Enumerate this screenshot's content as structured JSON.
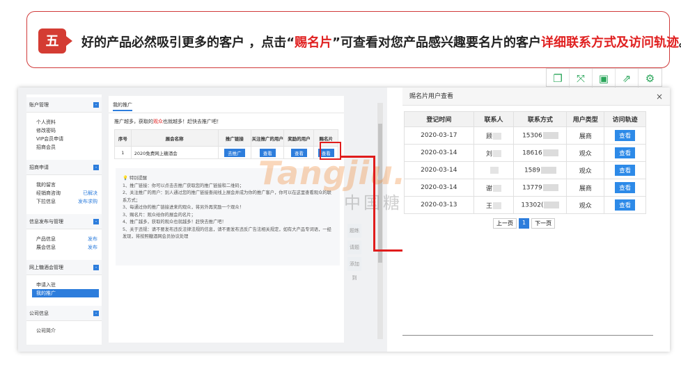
{
  "banner": {
    "step": "五",
    "text_part1": "好的产品必然吸引更多的客户 ，点击“",
    "text_red1": "赐名片",
    "text_part2": "”可查看对您产品感兴趣要名片的客户",
    "text_red2": "详细联系方式及访问轨迹",
    "text_part3": "。"
  },
  "toolbar": {
    "icons": [
      "copy-icon",
      "expand-icon",
      "save-icon",
      "share-icon",
      "settings-icon"
    ]
  },
  "sidebar": {
    "sections": [
      {
        "title": "账户管理",
        "items": [
          {
            "label": "个人资料"
          },
          {
            "label": "修改密码"
          },
          {
            "label": "VIP会员申请"
          },
          {
            "label": "招商会员"
          }
        ]
      },
      {
        "title": "招商申请",
        "items": [
          {
            "label": "我的留言"
          },
          {
            "label": "经销商咨询",
            "extra": "已解决"
          },
          {
            "label": "下拉信息",
            "extra": "发布求购"
          }
        ]
      },
      {
        "title": "信息发布与管理",
        "items": [
          {
            "label": "产品信息",
            "extra": "发布"
          },
          {
            "label": "展会信息",
            "extra": "发布"
          }
        ]
      },
      {
        "title": "网上糖酒会管理",
        "items": [
          {
            "label": "申请入驻"
          },
          {
            "label": "我的推广"
          }
        ]
      },
      {
        "title": "公司信息",
        "items": [
          {
            "label": "公司简介"
          }
        ]
      }
    ]
  },
  "content": {
    "tab": "我的推广",
    "hint_pre": "推广越多，获取的",
    "hint_red": "观众",
    "hint_post": "也就越多！赶快去推广吧！",
    "table_headers": [
      "序号",
      "展会名称",
      "推广链接",
      "关注推广的用户",
      "奖励的用户",
      "赐名片"
    ],
    "row": {
      "no": "1",
      "name": "2020免费网上糖酒会",
      "b1": "去推广",
      "b2": "查看",
      "b3": "查看",
      "b4": "查看"
    },
    "notice_title": "特别提醒",
    "notice_lines": [
      "1、推广链接：你可以点击去推广获取您的推广链接和二维码；",
      "2、关注推广的用户：别人通过您的推广链接查阅线上展会并成为你的推广客户，你可以在这里查看观众的联系方式；",
      "3、每通过你的推广链接进来的观众，将另外再奖励一个观众！",
      "3、赐名片：观众给你的展会的名片；",
      "4、推广越多，获取的观众也就越多！赶快去推广吧！",
      "5、关于违规：请不要发布违反法律法规的信息，请不要发布违反广告法相关规定，如有大产品专词语，一经发现，将按照糖酒网会员协议处理"
    ],
    "side_tags": [
      "题练",
      "请题",
      "添加到"
    ]
  },
  "watermark": {
    "logo": "Tangjiu.com",
    "cn": "中国糖酒网"
  },
  "dialog": {
    "title": "赐名片用户查看",
    "close": "×",
    "headers": [
      "登记时间",
      "联系人",
      "联系方式",
      "用户类型",
      "访问轨迹"
    ],
    "rows": [
      {
        "date": "2020-03-17",
        "name": "顾",
        "phone": "15306",
        "type": "展商",
        "action": "查看"
      },
      {
        "date": "2020-03-14",
        "name": "刘",
        "phone": "18616",
        "type": "观众",
        "action": "查看"
      },
      {
        "date": "2020-03-14",
        "name": "",
        "phone": "1589",
        "type": "观众",
        "action": "查看"
      },
      {
        "date": "2020-03-14",
        "name": "谢",
        "phone": "13779",
        "type": "展商",
        "action": "查看"
      },
      {
        "date": "2020-03-13",
        "name": "王",
        "phone": "13302(",
        "type": "观众",
        "action": "查看"
      }
    ],
    "pager": {
      "prev": "上一页",
      "current": "1",
      "next": "下一页"
    }
  }
}
